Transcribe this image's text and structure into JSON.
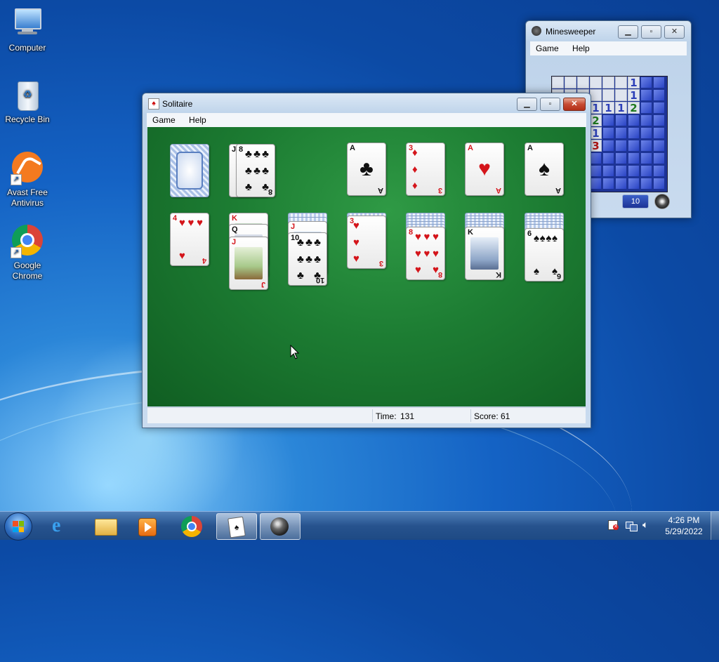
{
  "desktop": {
    "icons": [
      {
        "label": "Computer",
        "icon": "computer-icon"
      },
      {
        "label": "Recycle Bin",
        "icon": "recycle-bin-icon"
      },
      {
        "label": "Avast Free Antivirus",
        "icon": "avast-icon"
      },
      {
        "label": "Google Chrome",
        "icon": "chrome-icon"
      }
    ]
  },
  "minesweeper": {
    "title": "Minesweeper",
    "menu": [
      "Game",
      "Help"
    ],
    "mine_counter": "10",
    "visible_numbers": [
      "1",
      "1",
      "1",
      "1",
      "1",
      "2",
      "2",
      "1",
      "3"
    ]
  },
  "solitaire": {
    "title": "Solitaire",
    "menu": [
      "Game",
      "Help"
    ],
    "status": {
      "time_label": "Time:",
      "time_value": "131",
      "score_label": "Score:",
      "score_value": "61"
    },
    "waste": {
      "rank": "8",
      "suit": "♣",
      "under": "J"
    },
    "foundations": [
      {
        "rank": "A",
        "suit": "♣",
        "color": "black"
      },
      {
        "rank": "3",
        "suit": "♦",
        "color": "red"
      },
      {
        "rank": "A",
        "suit": "♥",
        "color": "red"
      },
      {
        "rank": "A",
        "suit": "♠",
        "color": "black"
      }
    ],
    "tableau": [
      {
        "rank": "4",
        "suit": "♥",
        "hidden": 0
      },
      {
        "stack": [
          "K",
          "Q",
          "J"
        ],
        "bottom_rank": "J"
      },
      {
        "rank": "10",
        "suit": "♣",
        "hidden": 2,
        "under": "J"
      },
      {
        "rank": "3",
        "suit": "♥",
        "hidden": 1
      },
      {
        "rank": "8",
        "suit": "♥",
        "hidden": 5
      },
      {
        "rank": "K",
        "suit": "♠",
        "hidden": 5
      },
      {
        "rank": "6",
        "suit": "♠",
        "hidden": 5
      }
    ]
  },
  "taskbar": {
    "apps": [
      "start-orb",
      "internet-explorer",
      "windows-explorer",
      "media-player",
      "chrome",
      "solitaire",
      "minesweeper"
    ],
    "clock_time": "4:26 PM",
    "clock_date": "5/29/2022"
  }
}
